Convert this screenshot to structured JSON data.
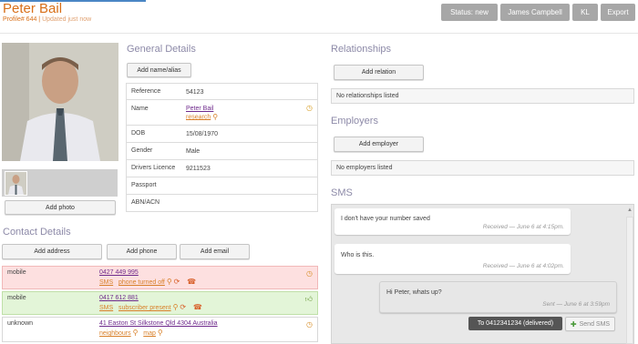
{
  "header": {
    "name": "Peter Bail",
    "profile_id": "Profile# 644",
    "separator": " | ",
    "updated": "Updated just now"
  },
  "toolbar": {
    "status": "Status: new",
    "assignee": "James Campbell",
    "initials": "KL",
    "export": "Export"
  },
  "photo": {
    "add_label": "Add photo"
  },
  "general": {
    "title": "General Details",
    "add_name": "Add name/alias",
    "reference_label": "Reference",
    "reference_value": "54123",
    "name_label": "Name",
    "name_value": "Peter Bail",
    "name_research": "research",
    "dob_label": "DOB",
    "dob_value": "15/08/1970",
    "gender_label": "Gender",
    "gender_value": "Male",
    "licence_label": "Drivers Licence",
    "licence_value": "9211523",
    "passport_label": "Passport",
    "passport_value": "",
    "abn_label": "ABN/ACN",
    "abn_value": ""
  },
  "contact": {
    "title": "Contact Details",
    "add_address": "Add address",
    "add_phone": "Add phone",
    "add_email": "Add email",
    "items": [
      {
        "type": "mobile",
        "value": "0427 449 995",
        "sms": "SMS",
        "note": "phone turned off",
        "bg": "#fde0e0",
        "border": "#f1b8b8"
      },
      {
        "type": "mobile",
        "value": "0417 612 881",
        "sms": "SMS",
        "note": "subscriber present",
        "bg": "#e3f5d8",
        "border": "#bfe0a8"
      },
      {
        "type": "unknown",
        "value": "41 Easton St Silkstone Qld 4304 Australia",
        "sms": "neighbours",
        "note": "map",
        "bg": "#ffffff",
        "border": "#d8d8d8"
      }
    ]
  },
  "relationships": {
    "title": "Relationships",
    "add": "Add relation",
    "empty": "No relationships listed"
  },
  "employers": {
    "title": "Employers",
    "add": "Add employer",
    "empty": "No employers listed"
  },
  "sms": {
    "title": "SMS",
    "messages": [
      {
        "text": "I don't have your number saved",
        "meta": "Received — June 6 at 4:15pm."
      },
      {
        "text": "Who is this.",
        "meta": "Received — June 6 at 4:02pm."
      },
      {
        "text": "Hi Peter, whats up?",
        "meta": "Sent — June 6 at 3:59pm"
      }
    ],
    "to_label": "To 0412341234 (delivered)",
    "send_label": "Send SMS"
  },
  "colors": {
    "accent": "#d86f18",
    "heading": "#8d8aa8",
    "link": "#6f2a8c",
    "button_grey": "#a7a7a7"
  }
}
